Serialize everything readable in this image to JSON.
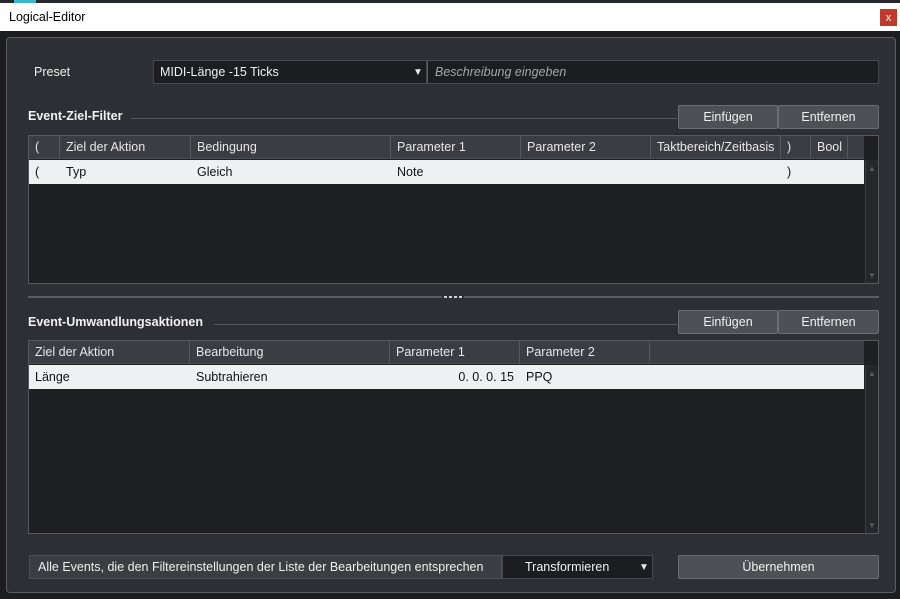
{
  "window": {
    "title": "Logical-Editor",
    "close_label": "x"
  },
  "preset": {
    "label": "Preset",
    "value": "MIDI-Länge -15 Ticks",
    "description_placeholder": "Beschreibung eingeben"
  },
  "filter": {
    "title": "Event-Ziel-Filter",
    "insert_label": "Einfügen",
    "remove_label": "Entfernen",
    "columns": [
      "(",
      "Ziel der Aktion",
      "Bedingung",
      "Parameter 1",
      "Parameter 2",
      "Taktbereich/Zeitbasis",
      ")",
      "Bool"
    ],
    "rows": [
      [
        "(",
        "Typ",
        "Gleich",
        "Note",
        "",
        "",
        ")",
        ""
      ]
    ]
  },
  "actions": {
    "title": "Event-Umwandlungsaktionen",
    "insert_label": "Einfügen",
    "remove_label": "Entfernen",
    "columns": [
      "Ziel der Aktion",
      "Bearbeitung",
      "Parameter 1",
      "Parameter 2"
    ],
    "rows": [
      [
        "Länge",
        "Subtrahieren",
        "0. 0. 0. 15",
        "PPQ"
      ]
    ]
  },
  "footer": {
    "description": "Alle Events, die den Filtereinstellungen der Liste der Bearbeitungen entsprechen",
    "function_value": "Transformieren",
    "apply_label": "Übernehmen"
  },
  "colors": {
    "accent": "#3ab6cf",
    "close_button": "#c0392b",
    "panel_bg": "#2c2f33",
    "row_selected": "#eef0f2"
  }
}
